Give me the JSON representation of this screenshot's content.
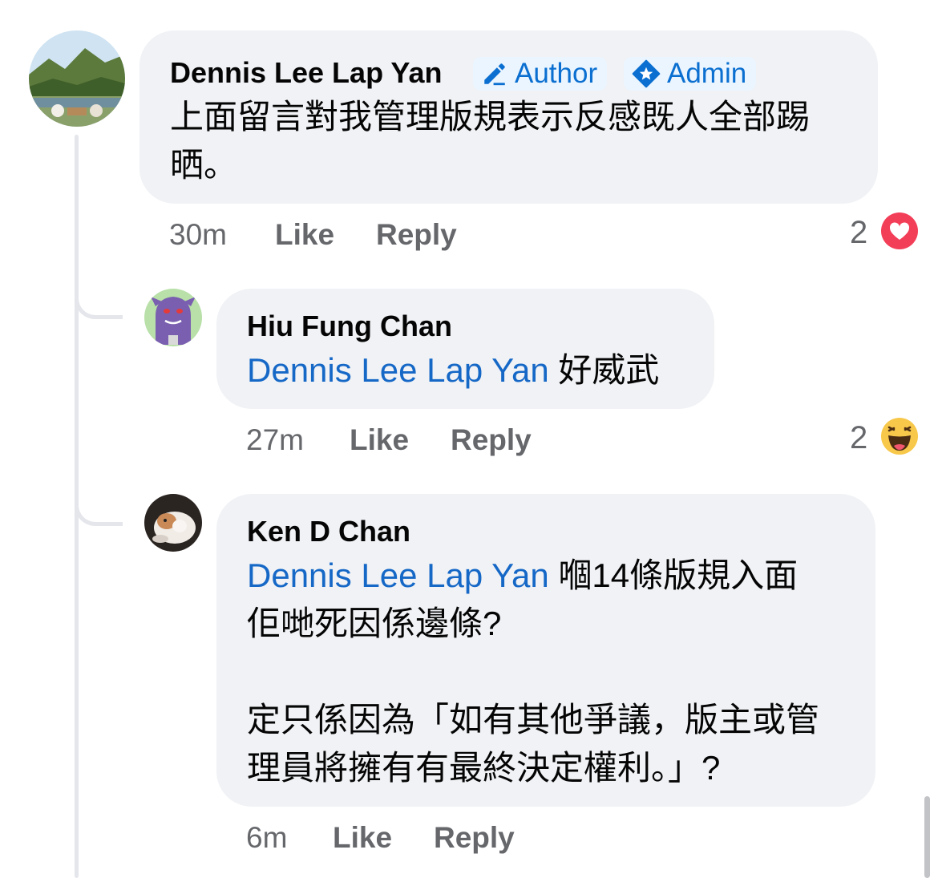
{
  "comments": [
    {
      "author": "Dennis Lee Lap Yan",
      "badges": [
        "Author",
        "Admin"
      ],
      "text_line1": "上面留言對我管理版規表示反感既人全部踢",
      "text_line2": "晒。",
      "time": "30m",
      "like_label": "Like",
      "reply_label": "Reply",
      "reaction_count": "2",
      "reaction_icon": "heart-icon"
    },
    {
      "author": "Hiu Fung Chan",
      "mention": "Dennis Lee Lap Yan",
      "text": " 好威武",
      "time": "27m",
      "like_label": "Like",
      "reply_label": "Reply",
      "reaction_count": "2",
      "reaction_icon": "haha-icon"
    },
    {
      "author": "Ken D Chan",
      "mention": "Dennis Lee Lap Yan",
      "text_line1": " 嗰14條版規入面",
      "text_line2": "佢哋死因係邊條?",
      "text_line3": "定只係因為「如有其他爭議，版主或管",
      "text_line4": "理員將擁有有最終決定權利。」?",
      "time": "6m",
      "like_label": "Like",
      "reply_label": "Reply"
    }
  ],
  "colors": {
    "bubble": "#f0f2f5",
    "mention": "#1668c7",
    "badge_text": "#0a6fd0",
    "meta": "#65676b",
    "heart": "#f33e58"
  }
}
